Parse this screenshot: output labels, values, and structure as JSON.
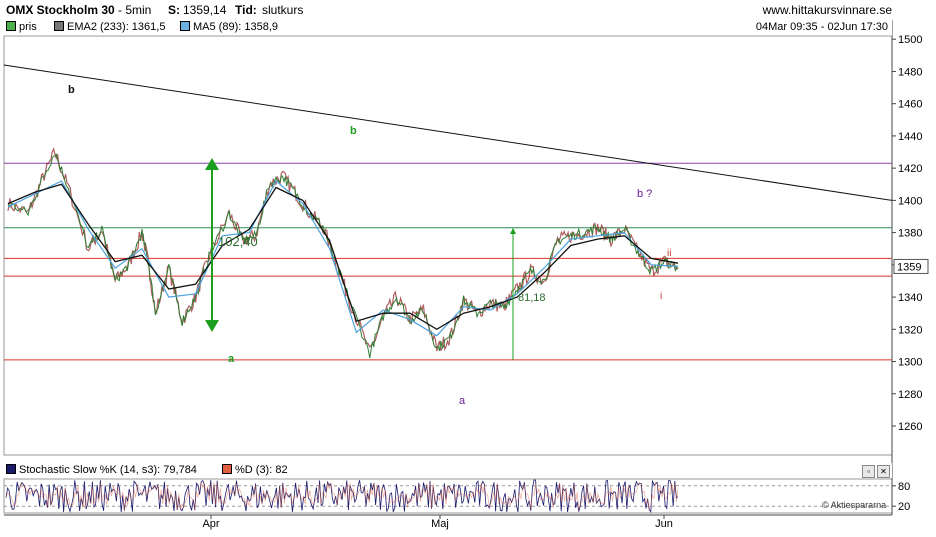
{
  "header": {
    "symbol": "OMX Stockholm 30",
    "interval": "-  5min",
    "s_label": "S:",
    "s_value": "1359,14",
    "tid_label": "Tid:",
    "tid_value": "slutkurs",
    "site": "www.hittakursvinnare.se"
  },
  "legend": [
    {
      "label": "pris",
      "color": "#4caf50"
    },
    {
      "label": "EMA2 (233): 1361,5",
      "color": "#777777"
    },
    {
      "label": "MA5 (89): 1358,9",
      "color": "#6ab0e0"
    }
  ],
  "date_range": "04Mar 09:35 - 02Jun 17:30",
  "price_tag": "1359",
  "annotations": {
    "b_top": "b",
    "b_mid": "b",
    "a_left": "a",
    "a_mid": "a",
    "b_q": "b ?",
    "ii": "ii",
    "i": "i",
    "move1": "102,40",
    "move2": "81,18"
  },
  "stochastic": {
    "k_label": "Stochastic Slow %K (14, s3): 79,784",
    "d_label": "%D (3): 82",
    "k_color": "#1a1a6e",
    "d_color": "#e06040",
    "levels": [
      80,
      20
    ]
  },
  "credit": "© Aktiespararna",
  "chart_data": {
    "type": "line",
    "title": "OMX Stockholm 30 - 5min",
    "y_ticks": [
      1260,
      1280,
      1300,
      1320,
      1340,
      1360,
      1380,
      1400,
      1420,
      1440,
      1460,
      1480,
      1500
    ],
    "x_ticks": [
      "Apr",
      "Maj",
      "Jun"
    ],
    "ylim": [
      1242,
      1502
    ],
    "x_range": [
      "04Mar 09:35",
      "02Jun 17:30"
    ],
    "horizontal_levels": [
      {
        "value": 1423,
        "color": "#8e44ad"
      },
      {
        "value": 1383,
        "color": "#2e8b57"
      },
      {
        "value": 1364,
        "color": "#d9342b"
      },
      {
        "value": 1353,
        "color": "#d9342b"
      },
      {
        "value": 1301,
        "color": "#d9342b"
      }
    ],
    "trendline": {
      "start_value": 1484,
      "end_value": 1400
    },
    "series": [
      {
        "name": "pris",
        "color": "#2e7d32",
        "x": [
          0,
          3,
          5,
          7,
          9,
          12,
          14,
          16,
          18,
          20,
          21,
          22,
          24,
          26,
          28,
          30,
          33,
          35,
          37,
          39,
          41,
          43,
          45,
          47,
          49,
          51,
          54,
          56,
          58,
          60,
          62,
          64,
          66,
          68,
          70,
          72,
          74,
          76,
          78,
          80,
          82,
          84,
          86,
          88,
          90,
          92,
          94,
          96,
          98,
          100
        ],
        "y": [
          1398,
          1392,
          1412,
          1430,
          1408,
          1370,
          1382,
          1350,
          1360,
          1380,
          1360,
          1330,
          1358,
          1325,
          1340,
          1365,
          1392,
          1375,
          1378,
          1410,
          1415,
          1404,
          1392,
          1384,
          1360,
          1338,
          1305,
          1328,
          1340,
          1326,
          1332,
          1308,
          1315,
          1338,
          1330,
          1336,
          1334,
          1345,
          1356,
          1350,
          1375,
          1378,
          1380,
          1383,
          1376,
          1382,
          1368,
          1356,
          1362,
          1358
        ]
      },
      {
        "name": "EMA2 (233)",
        "color": "#111111",
        "x": [
          0,
          4,
          8,
          12,
          16,
          20,
          24,
          28,
          32,
          36,
          40,
          44,
          48,
          52,
          56,
          60,
          64,
          68,
          72,
          76,
          80,
          84,
          88,
          92,
          96,
          100
        ],
        "y": [
          1398,
          1405,
          1410,
          1385,
          1362,
          1366,
          1345,
          1348,
          1372,
          1382,
          1408,
          1400,
          1375,
          1325,
          1330,
          1330,
          1320,
          1330,
          1334,
          1340,
          1355,
          1372,
          1376,
          1378,
          1364,
          1361
        ]
      },
      {
        "name": "MA5 (89)",
        "color": "#4aa3df",
        "x": [
          0,
          4,
          8,
          12,
          16,
          20,
          24,
          28,
          32,
          36,
          40,
          44,
          48,
          52,
          56,
          60,
          64,
          68,
          72,
          76,
          80,
          84,
          88,
          92,
          96,
          100
        ],
        "y": [
          1396,
          1404,
          1412,
          1382,
          1358,
          1370,
          1340,
          1342,
          1378,
          1380,
          1412,
          1398,
          1370,
          1318,
          1332,
          1326,
          1316,
          1334,
          1332,
          1342,
          1358,
          1376,
          1378,
          1380,
          1360,
          1359
        ]
      }
    ]
  }
}
